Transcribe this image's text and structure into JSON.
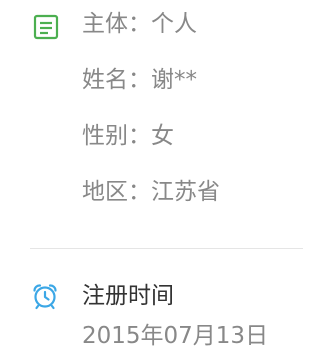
{
  "profile": {
    "subject_label": "主体：",
    "subject_value": "个人",
    "name_label": "姓名：",
    "name_value": "谢**",
    "gender_label": "性别：",
    "gender_value": "女",
    "region_label": "地区：",
    "region_value": "江苏省",
    "icon": "document-list-icon"
  },
  "registration": {
    "title": "注册时间",
    "date": "2015年07月13日",
    "icon": "alarm-clock-icon"
  },
  "colors": {
    "doc_icon": "#4CAF50",
    "alarm_icon": "#3BA7E6",
    "label_text": "#888888",
    "title_text": "#333333",
    "divider": "#E5E5E5"
  }
}
